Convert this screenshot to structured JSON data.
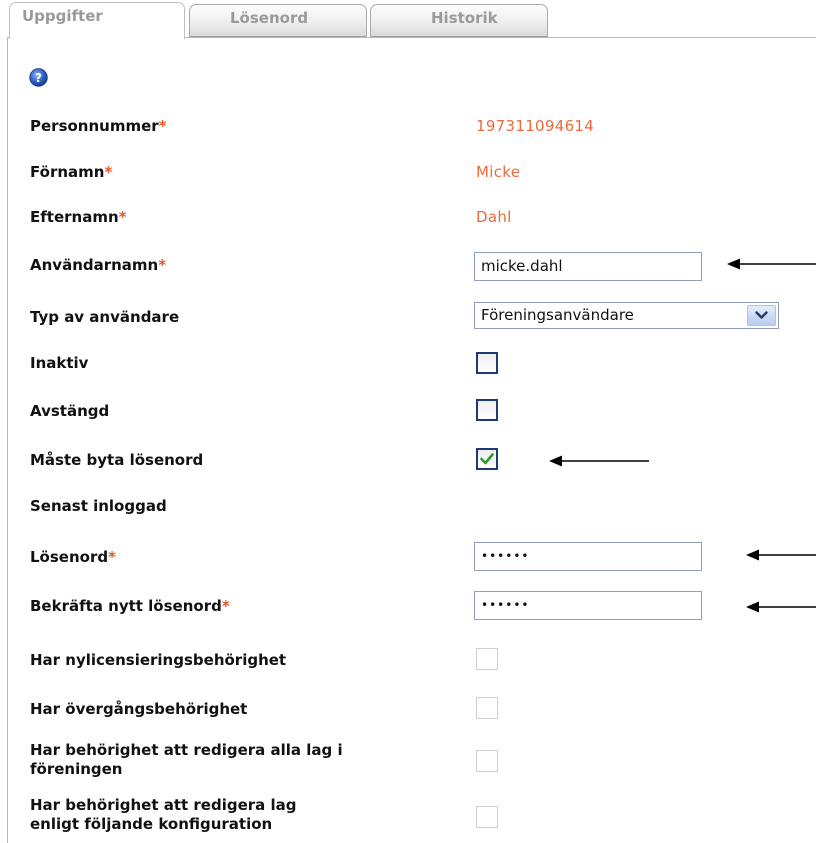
{
  "tabs": [
    {
      "label": "Uppgifter",
      "active": true
    },
    {
      "label": "Lösenord",
      "active": false
    },
    {
      "label": "Historik",
      "active": false
    }
  ],
  "help_icon": "help-question-icon",
  "fields": {
    "personnummer": {
      "label": "Personnummer",
      "required": "*",
      "value": "197311094614"
    },
    "fornamn": {
      "label": "Förnamn",
      "required": "*",
      "value": "Micke"
    },
    "efternamn": {
      "label": "Efternamn",
      "required": "*",
      "value": "Dahl"
    },
    "anvandarnamn": {
      "label": "Användarnamn",
      "required": "*",
      "value": "micke.dahl"
    },
    "typ": {
      "label": "Typ av användare",
      "selected": "Föreningsanvändare"
    },
    "inaktiv": {
      "label": "Inaktiv",
      "checked": false
    },
    "avstangd": {
      "label": "Avstängd",
      "checked": false
    },
    "maste_byta": {
      "label": "Måste byta lösenord",
      "checked": true
    },
    "senast_inloggad": {
      "label": "Senast inloggad",
      "value": ""
    },
    "losenord": {
      "label": "Lösenord",
      "required": "*",
      "value": "••••••"
    },
    "bekrafta": {
      "label": "Bekräfta nytt lösenord",
      "required": "*",
      "value": "••••••"
    },
    "nylicens": {
      "label": "Har nylicensieringsbehörighet",
      "checked": false,
      "disabled": true
    },
    "overgang": {
      "label": "Har övergångsbehörighet",
      "checked": false,
      "disabled": true
    },
    "alla_lag_1": {
      "label": "Har behörighet att redigera alla lag i",
      "checked": false,
      "disabled": true
    },
    "alla_lag_2": {
      "label": "föreningen"
    },
    "konfig_1": {
      "label": "Har behörighet att redigera lag",
      "checked": false,
      "disabled": true
    },
    "konfig_2": {
      "label": "enligt följande konfiguration"
    }
  },
  "colors": {
    "label": "#111111",
    "required_asterisk": "#e35a26",
    "readonly_value": "#ec6a3a",
    "input_border": "#8f9fb8",
    "checkmark": "#2e9a2e",
    "help_icon": "#1f4fb3"
  }
}
